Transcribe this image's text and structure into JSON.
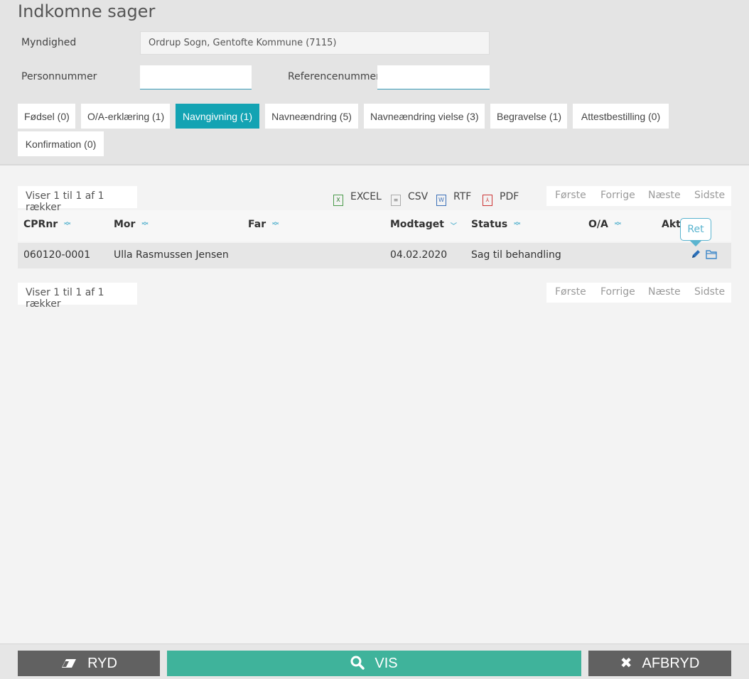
{
  "page": {
    "title": "Indkomne sager"
  },
  "form": {
    "myndighed_label": "Myndighed",
    "myndighed_value": "Ordrup Sogn, Gentofte Kommune (7115)",
    "personnummer_label": "Personnummer",
    "personnummer_value": "",
    "referencenummer_label": "Referencenummer",
    "referencenummer_value": ""
  },
  "tabs": [
    {
      "label": "Fødsel (0)",
      "active": false
    },
    {
      "label": "O/A-erklæring (1)",
      "active": false
    },
    {
      "label": "Navngivning (1)",
      "active": true
    },
    {
      "label": "Navneændring (5)",
      "active": false
    },
    {
      "label": "Navneændring vielse (3)",
      "active": false
    },
    {
      "label": "Begravelse (1)",
      "active": false
    },
    {
      "label": "Attestbestilling (0)",
      "active": false
    },
    {
      "label": "Konfirmation (0)",
      "active": false
    }
  ],
  "table_info": {
    "top": "Viser 1 til 1 af 1 rækker",
    "bottom": "Viser 1 til 1 af 1 rækker"
  },
  "export": {
    "excel": "EXCEL",
    "csv": "CSV",
    "rtf": "RTF",
    "pdf": "PDF"
  },
  "pager": {
    "first": "Første",
    "prev": "Forrige",
    "next": "Næste",
    "last": "Sidste"
  },
  "columns": {
    "cprnr": "CPRnr",
    "mor": "Mor",
    "far": "Far",
    "modtaget": "Modtaget",
    "status": "Status",
    "oa": "O/A",
    "aktion": "Akti"
  },
  "rows": [
    {
      "cprnr": "060120-0001",
      "mor": "Ulla Rasmussen Jensen",
      "far": "",
      "modtaget": "04.02.2020",
      "status": "Sag til behandling",
      "oa": ""
    }
  ],
  "tooltip": "Ret",
  "footer": {
    "ryd": "RYD",
    "vis": "VIS",
    "afbryd": "AFBRYD"
  },
  "colors": {
    "accent": "#13a3b3",
    "vis_button": "#3fb39b",
    "dark_button": "#616161",
    "link_blue": "#3a86c8"
  },
  "icons": {
    "ryd": "eraser-icon",
    "vis": "search-icon",
    "afbryd": "close-icon",
    "edit": "pencil-icon",
    "open": "folder-icon"
  }
}
